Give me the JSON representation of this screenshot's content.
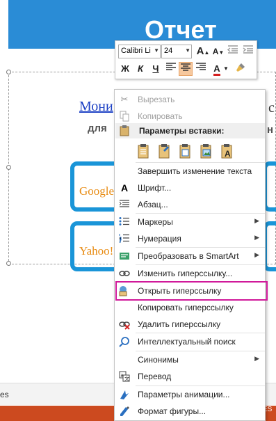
{
  "slide": {
    "title": "Отчет",
    "link_text": "Мони",
    "right_letter": "с",
    "subtitle": "для",
    "right_subtitle": "н",
    "brand_google": "Google",
    "brand_yahoo": "Yahoo!",
    "bottom_left": "es",
    "bottom_right": "ES"
  },
  "mini_toolbar": {
    "font_name": "Calibri Li",
    "font_size": "24",
    "bold": "Ж",
    "italic": "К",
    "underline": "Ч",
    "grow_font": "A",
    "shrink_font": "A",
    "font_color_letter": "A"
  },
  "context_menu": {
    "cut": "Вырезать",
    "copy": "Копировать",
    "paste_options": "Параметры вставки:",
    "finish_edit": "Завершить изменение текста",
    "font": "Шрифт...",
    "paragraph": "Абзац...",
    "bullets": "Маркеры",
    "numbering": "Нумерация",
    "smartart": "Преобразовать в SmartArt",
    "edit_link": "Изменить гиперссылку...",
    "open_link": "Открыть гиперссылку",
    "copy_link": "Копировать гиперссылку",
    "remove_link": "Удалить гиперссылку",
    "smart_lookup": "Интеллектуальный поиск",
    "synonyms": "Синонимы",
    "translate": "Перевод",
    "animation": "Параметры анимации...",
    "format_shape": "Формат фигуры..."
  },
  "colors": {
    "header_blue": "#2a8cd6",
    "link_blue": "#1b3fc4",
    "brace_blue": "#1a95d8",
    "brand_orange": "#e88b12",
    "highlight_magenta": "#d0199a",
    "bottom_orange": "#cc4a1f"
  }
}
